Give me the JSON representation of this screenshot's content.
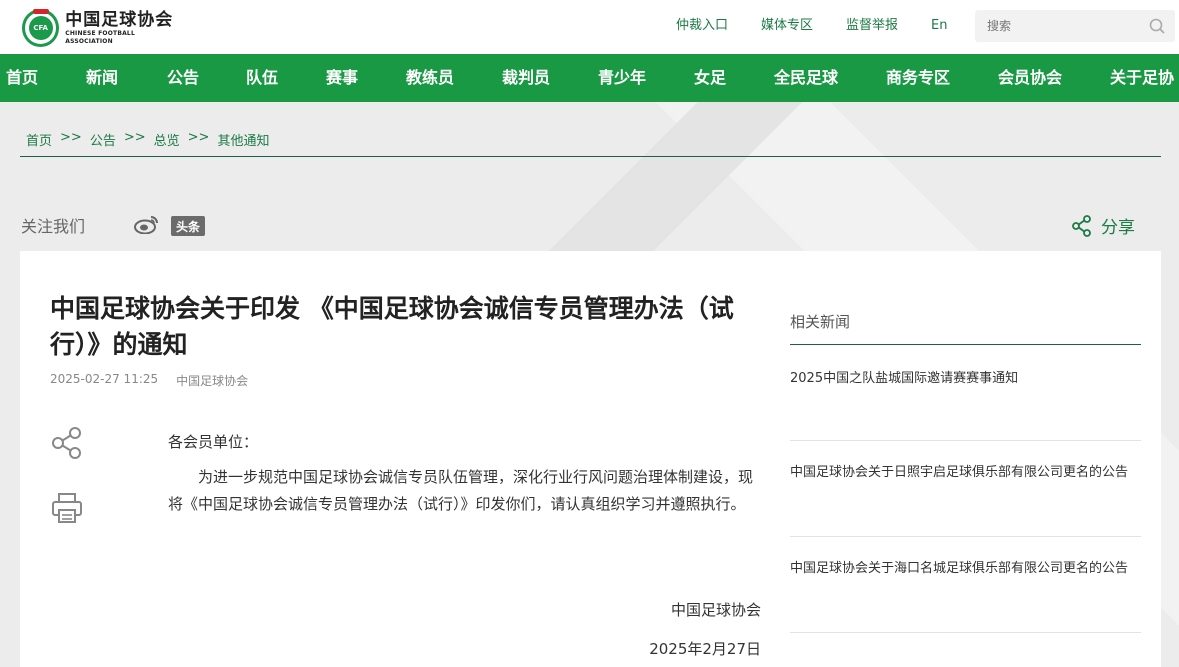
{
  "header": {
    "logo_cn": "中国足球协会",
    "logo_en": "CHINESE FOOTBALL ASSOCIATION",
    "logo_badge": "CFA",
    "links": [
      "仲裁入口",
      "媒体专区",
      "监督举报",
      "En"
    ],
    "search_placeholder": "搜索"
  },
  "nav": [
    "首页",
    "新闻",
    "公告",
    "队伍",
    "赛事",
    "教练员",
    "裁判员",
    "青少年",
    "女足",
    "全民足球",
    "商务专区",
    "会员协会",
    "关于足协"
  ],
  "breadcrumb": [
    "首页",
    "公告",
    "总览",
    "其他通知"
  ],
  "breadcrumb_sep": ">>",
  "follow": {
    "label": "关注我们",
    "toutiao": "头条",
    "share": "分享"
  },
  "article": {
    "title": "中国足球协会关于印发 《中国足球协会诚信专员管理办法（试行）》的通知",
    "date": "2025-02-27 11:25",
    "source": "中国足球协会",
    "salutation": "各会员单位：",
    "paragraph": "为进一步规范中国足球协会诚信专员队伍管理，深化行业行风问题治理体制建设，现将《中国足球协会诚信专员管理办法（试行）》印发你们，请认真组织学习并遵照执行。",
    "signature": "中国足球协会",
    "sign_date": "2025年2月27日"
  },
  "related": {
    "title": "相关新闻",
    "items": [
      "2025中国之队盐城国际邀请赛赛事通知",
      "中国足球协会关于日照宇启足球俱乐部有限公司更名的公告",
      "中国足球协会关于海口名城足球俱乐部有限公司更名的公告"
    ]
  },
  "colors": {
    "brand_green": "#1a9944",
    "link_green": "#1b7a45",
    "dark_line": "#1f5f45"
  }
}
